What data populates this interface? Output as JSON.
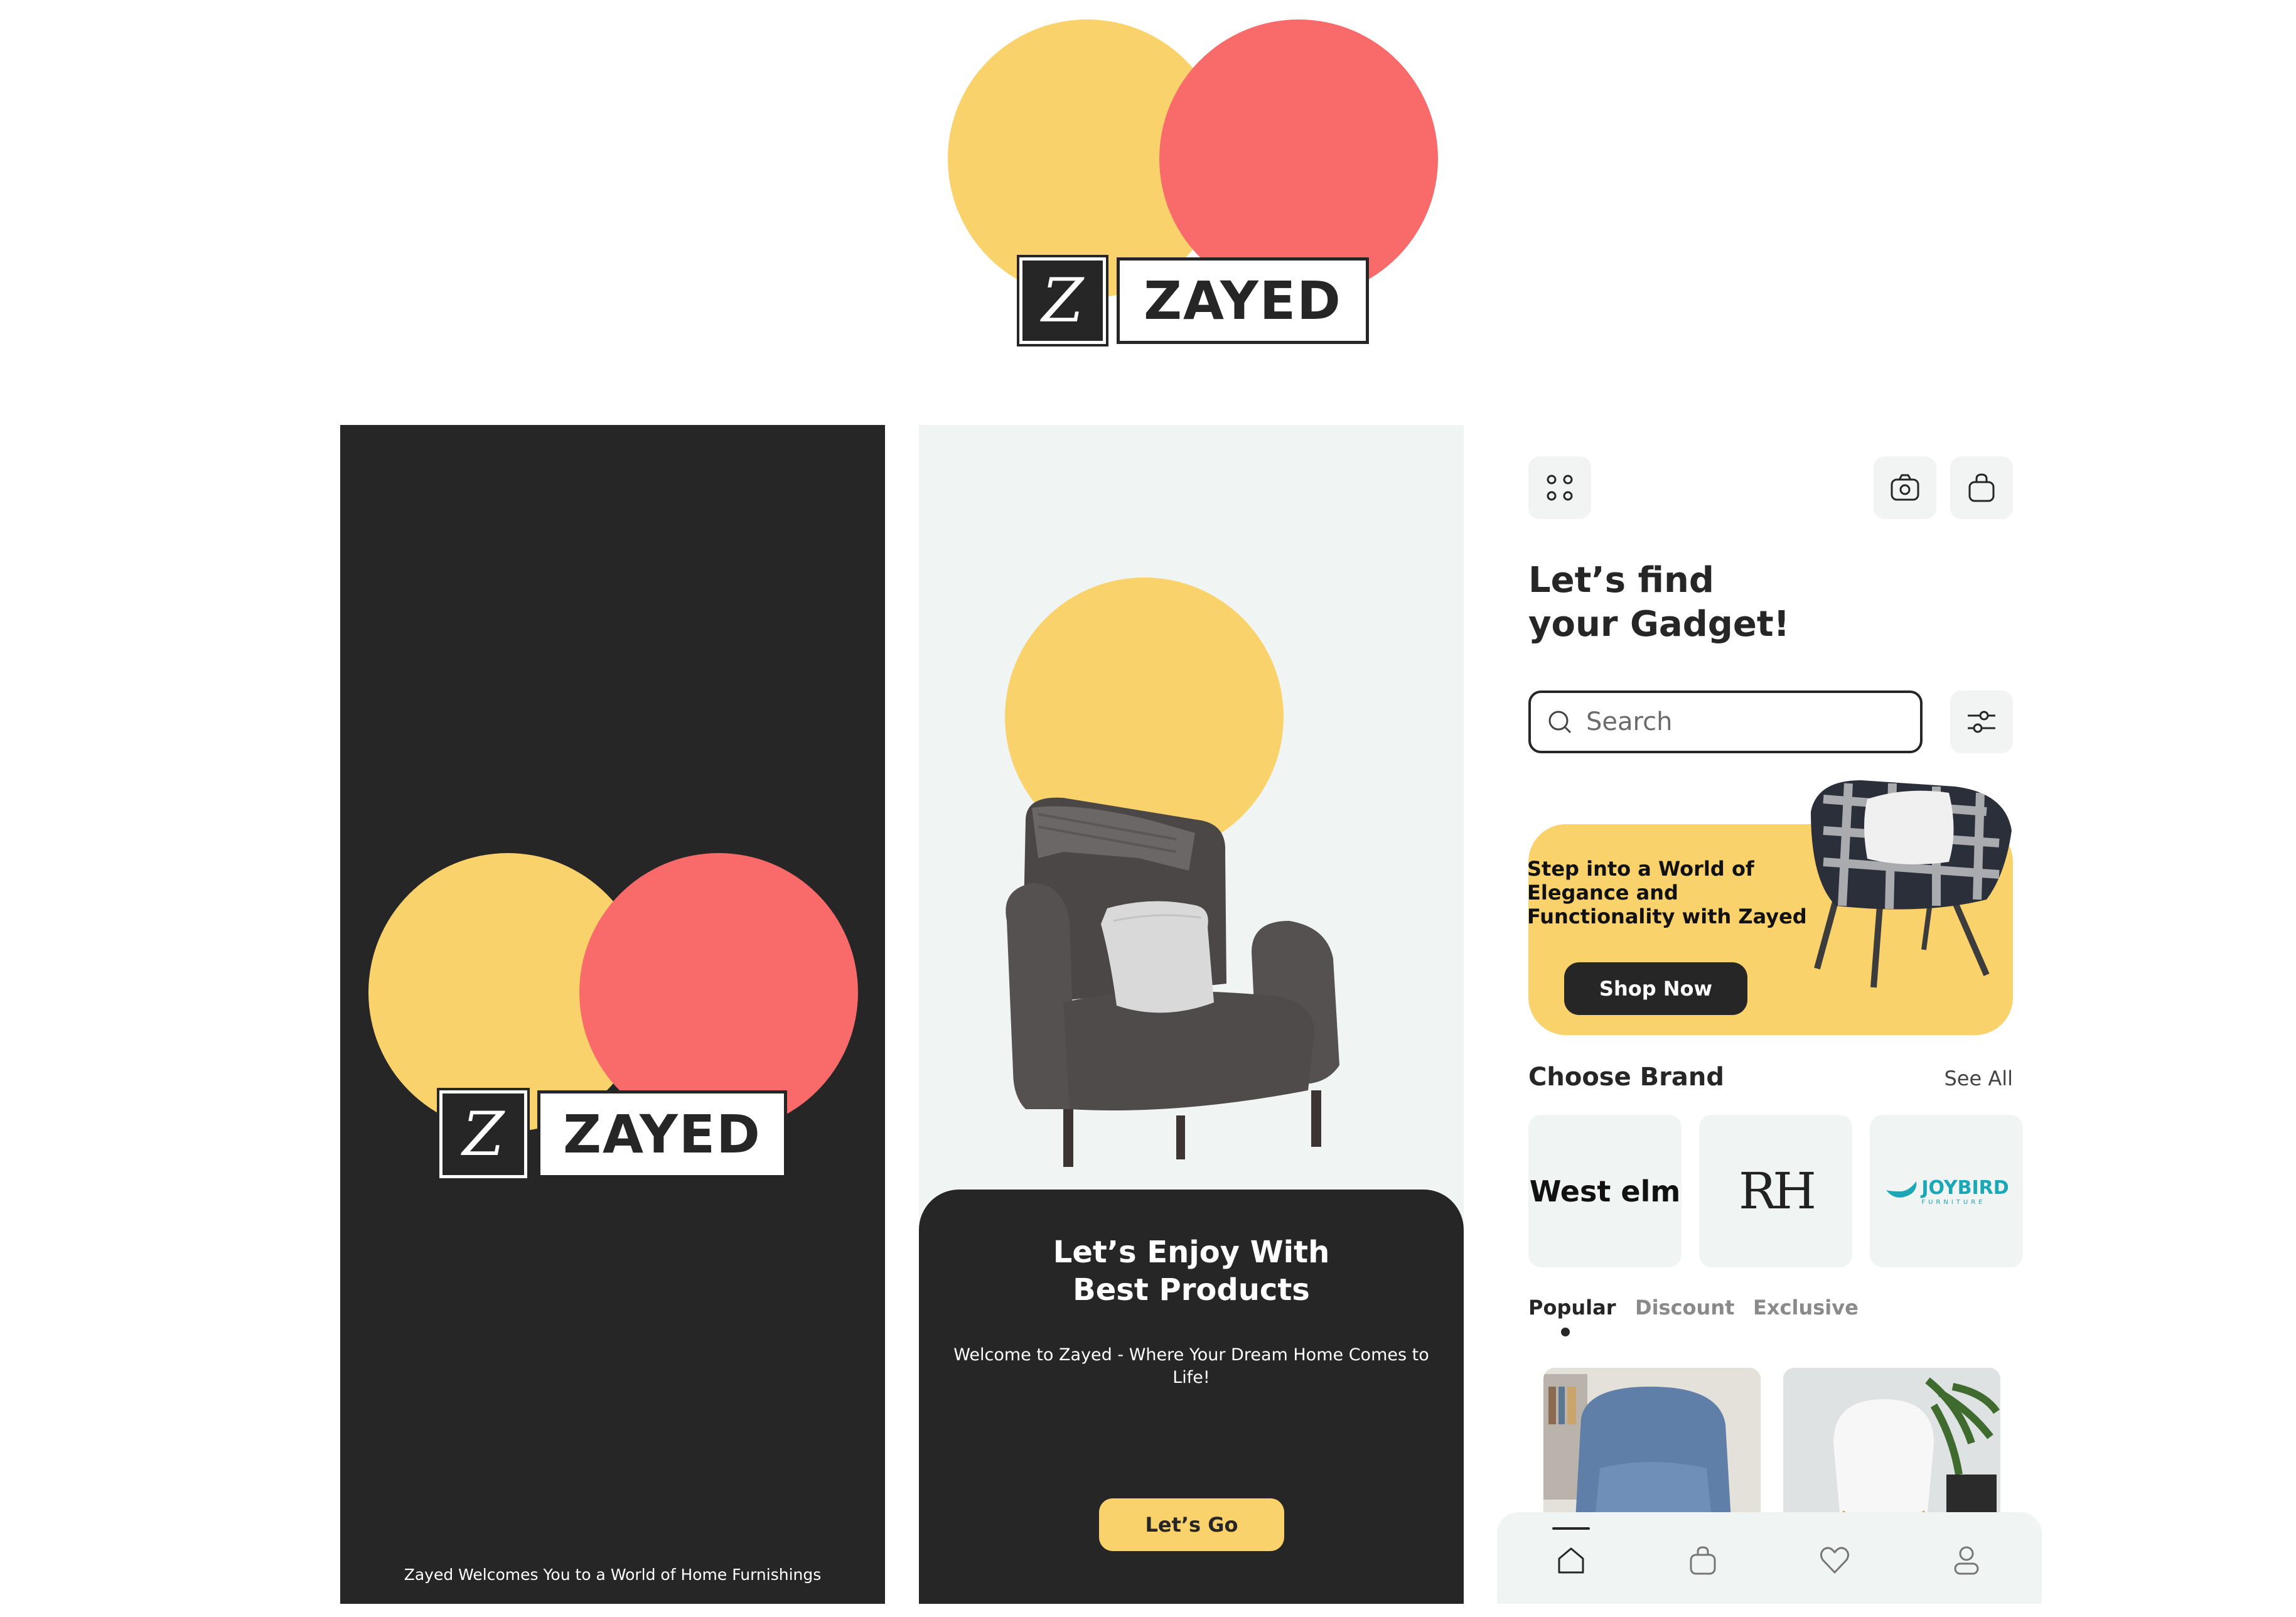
{
  "brand": {
    "z_mark": "Z",
    "wordmark": "ZAYED",
    "colors": {
      "yellow": "#F9D26B",
      "coral": "#F96B6B",
      "dark": "#262626",
      "mint": "#F0F5F4"
    }
  },
  "splash": {
    "footer_text": "Zayed Welcomes You to a World of Home Furnishings"
  },
  "onboarding": {
    "title_line1": "Let’s Enjoy With",
    "title_line2": "Best Products",
    "subtitle": "Welcome to Zayed - Where Your Dream Home Comes to Life!",
    "cta_label": "Let’s Go"
  },
  "home": {
    "header": {
      "menu_icon": "grid-icon",
      "camera_icon": "camera-icon",
      "bag_icon": "shopping-bag-icon"
    },
    "title_line1": "Let’s find",
    "title_line2": "your Gadget!",
    "search": {
      "placeholder": "Search"
    },
    "banner": {
      "text": "Step into a World of Elegance and Functionality with Zayed",
      "button_label": "Shop Now"
    },
    "brands_section": {
      "title": "Choose Brand",
      "see_all_label": "See All",
      "brands": [
        {
          "name": "West elm"
        },
        {
          "name": "RH"
        },
        {
          "name": "JOYBIRD",
          "tagline": "FURNITURE",
          "color": "#1BA7B5"
        }
      ]
    },
    "tabs": [
      {
        "label": "Popular",
        "active": true
      },
      {
        "label": "Discount",
        "active": false
      },
      {
        "label": "Exclusive",
        "active": false
      }
    ],
    "bottom_nav": [
      {
        "icon": "home-icon",
        "active": true
      },
      {
        "icon": "bag-icon",
        "active": false
      },
      {
        "icon": "heart-icon",
        "active": false
      },
      {
        "icon": "profile-icon",
        "active": false
      }
    ]
  }
}
